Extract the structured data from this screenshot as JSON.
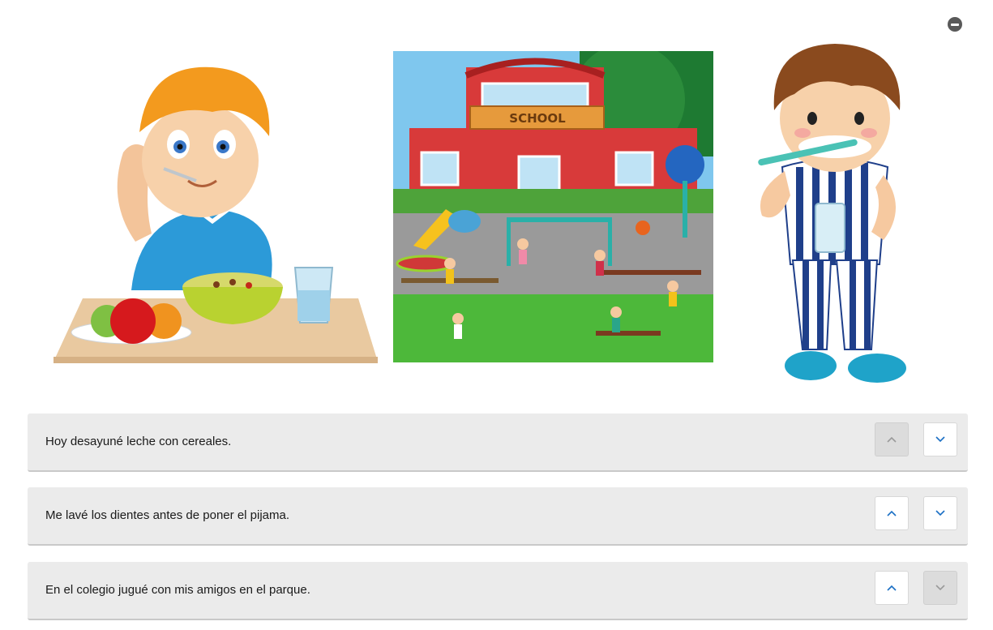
{
  "header": {
    "collapse_icon": "minus-circle-icon"
  },
  "images": [
    {
      "name": "boy-eating-cereal",
      "icon": "breakfast-illustration"
    },
    {
      "name": "school-playground",
      "icon": "school-illustration",
      "sign_text": "SCHOOL"
    },
    {
      "name": "boy-brushing-teeth",
      "icon": "toothbrush-illustration"
    }
  ],
  "items": [
    {
      "text": "Hoy desayuné leche con cereales.",
      "up_enabled": false,
      "down_enabled": true
    },
    {
      "text": "Me lavé los dientes antes de poner el pijama.",
      "up_enabled": true,
      "down_enabled": true
    },
    {
      "text": "En el colegio jugué con mis amigos en el parque.",
      "up_enabled": true,
      "down_enabled": false
    }
  ],
  "colors": {
    "arrow_enabled": "#1a6fc4",
    "arrow_disabled": "#9a9a9a",
    "item_bg": "#ebebeb"
  }
}
